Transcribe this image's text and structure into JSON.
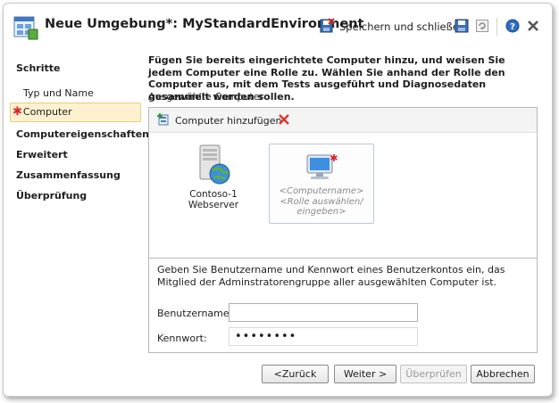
{
  "window": {
    "title": "Neue Umgebung*: MyStandardEnvironment",
    "save_close_label": "Speichern und schließen"
  },
  "sidebar": {
    "title": "Schritte",
    "items": [
      {
        "label": "Typ und Name"
      },
      {
        "label": "Computer",
        "active": true,
        "required": true
      },
      {
        "label": "Computereigenschaften"
      },
      {
        "label": "Erweitert"
      },
      {
        "label": "Zusammenfassung"
      },
      {
        "label": "Überprüfung"
      }
    ]
  },
  "main": {
    "instructions": "Fügen Sie bereits eingerichtete Computer hinzu, und weisen Sie jedem Computer eine Rolle zu. Wählen Sie anhand der Rolle den Computer aus, mit dem Tests ausgeführt und Diagnosedaten gesammelt werden sollen.",
    "selected_computers_label": "Ausgewählte Computer",
    "add_computer_label": "Computer hinzufügen",
    "computers": [
      {
        "name": "Contoso-1",
        "role": "Webserver"
      },
      {
        "name_placeholder": "<Computername>",
        "role_placeholder": "<Rolle auswählen/ eingeben>"
      }
    ],
    "credentials_text": "Geben Sie Benutzername und Kennwort eines Benutzerkontos ein, das Mitglied der Adminstratorengruppe aller ausgewählten Computer ist.",
    "username_label": "Benutzername:",
    "username_value": "",
    "password_label": "Kennwort:",
    "password_value": "••••••••"
  },
  "buttons": {
    "back": "<Zurück",
    "next": "Weiter >",
    "check": "Überprüfen",
    "cancel": "Abbrechen"
  },
  "colors": {
    "accent_required": "#d9272e",
    "active_step_bg": "#fdf1cf",
    "active_step_border": "#e9cd7e"
  }
}
